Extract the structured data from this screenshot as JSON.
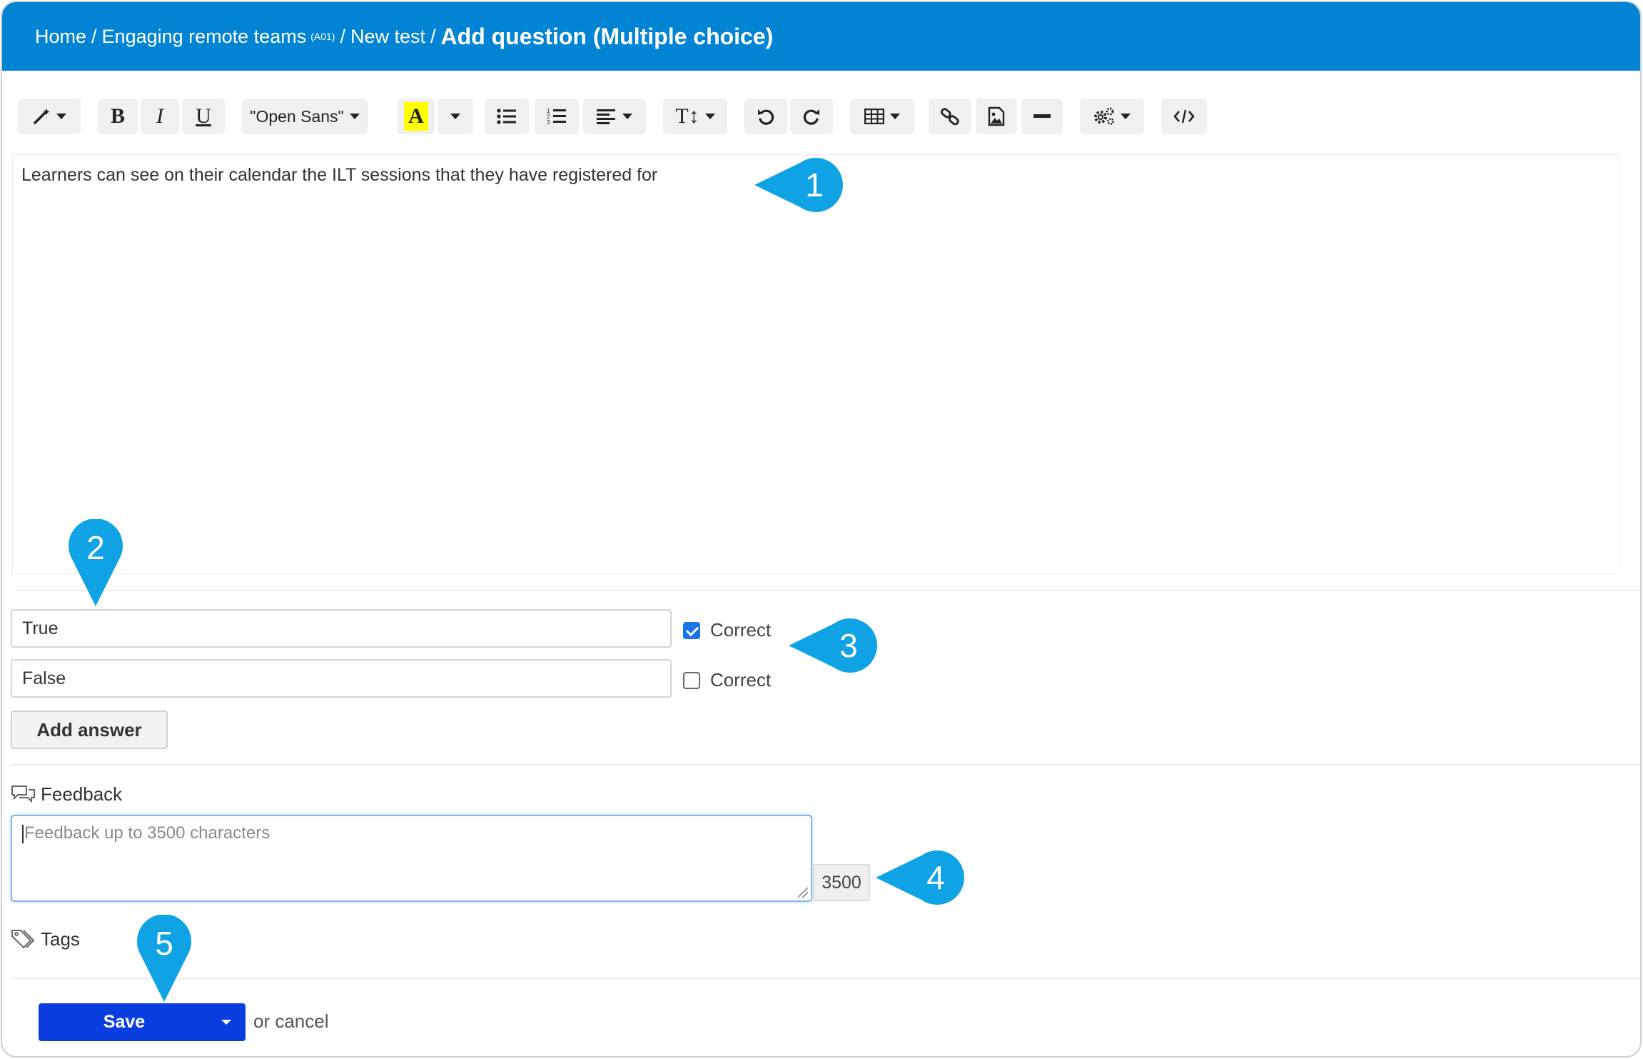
{
  "breadcrumb": {
    "items": [
      "Home",
      "Engaging remote teams",
      "New test"
    ],
    "course_code": "(A01)",
    "separator": "/",
    "current": "Add question (Multiple choice)"
  },
  "toolbar": {
    "bold": "B",
    "italic": "I",
    "underline": "U",
    "font_family": "\"Open Sans\"",
    "highlight_letter": "A",
    "font_size_glyph": "T↕"
  },
  "question": {
    "text": "Learners can see on their calendar the ILT sessions that they have registered for"
  },
  "answers": [
    {
      "value": "True",
      "correct": true,
      "correct_label": "Correct"
    },
    {
      "value": "False",
      "correct": false,
      "correct_label": "Correct"
    }
  ],
  "add_answer_label": "Add answer",
  "feedback": {
    "label": "Feedback",
    "placeholder": "Feedback up to 3500 characters",
    "char_count": "3500"
  },
  "tags": {
    "label": "Tags"
  },
  "actions": {
    "save_label": "Save",
    "cancel_label": "or cancel"
  },
  "callouts": [
    "1",
    "2",
    "3",
    "4",
    "5"
  ],
  "colors": {
    "header": "#0284d4",
    "save": "#0b3ee0",
    "callout": "#0fa3e6",
    "highlight": "#ffff00"
  }
}
